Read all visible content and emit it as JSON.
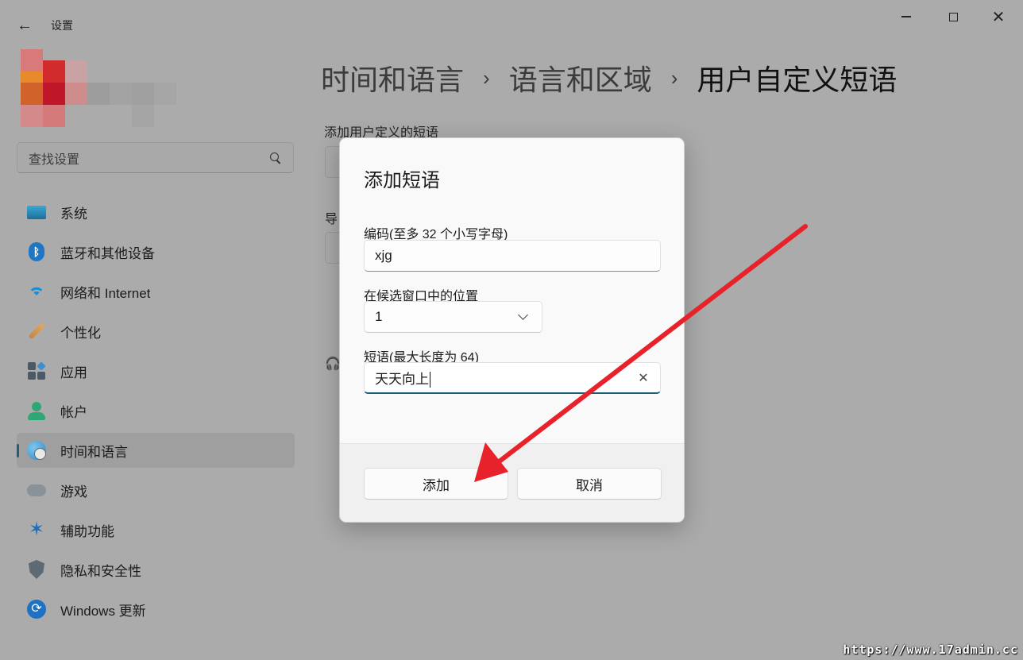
{
  "window": {
    "back_icon": "arrow-left-icon",
    "app_title": "设置",
    "controls": [
      "minimize-icon",
      "maximize-icon",
      "close-icon"
    ]
  },
  "sidebar": {
    "search_placeholder": "查找设置",
    "search_icon": "search-icon",
    "items": [
      {
        "label": "系统",
        "icon": "monitor-icon",
        "active": false
      },
      {
        "label": "蓝牙和其他设备",
        "icon": "bluetooth-icon",
        "active": false
      },
      {
        "label": "网络和 Internet",
        "icon": "wifi-icon",
        "active": false
      },
      {
        "label": "个性化",
        "icon": "brush-icon",
        "active": false
      },
      {
        "label": "应用",
        "icon": "apps-icon",
        "active": false
      },
      {
        "label": "帐户",
        "icon": "person-icon",
        "active": false
      },
      {
        "label": "时间和语言",
        "icon": "globe-clock-icon",
        "active": true
      },
      {
        "label": "游戏",
        "icon": "gamepad-icon",
        "active": false
      },
      {
        "label": "辅助功能",
        "icon": "accessibility-icon",
        "active": false
      },
      {
        "label": "隐私和安全性",
        "icon": "shield-icon",
        "active": false
      },
      {
        "label": "Windows 更新",
        "icon": "sync-icon",
        "active": false
      }
    ]
  },
  "breadcrumb": {
    "parts": [
      "时间和语言",
      "语言和区域"
    ],
    "separator": "›",
    "current": "用户自定义短语"
  },
  "main": {
    "section_label": "添加用户定义的短语",
    "partial_label": "导"
  },
  "dialog": {
    "title": "添加短语",
    "code_label": "编码(至多 32 个小写字母)",
    "code_value": "xjg",
    "position_label": "在候选窗口中的位置",
    "position_value": "1",
    "phrase_label": "短语(最大长度为 64)",
    "phrase_value": "天天向上",
    "clear_icon": "close-icon",
    "add_button": "添加",
    "cancel_button": "取消"
  },
  "annotation": {
    "color": "#e8222b"
  },
  "watermark": "https://www.17admin.cc",
  "colors": {
    "accent": "#1a5d7a",
    "overlay": "#ababab"
  }
}
